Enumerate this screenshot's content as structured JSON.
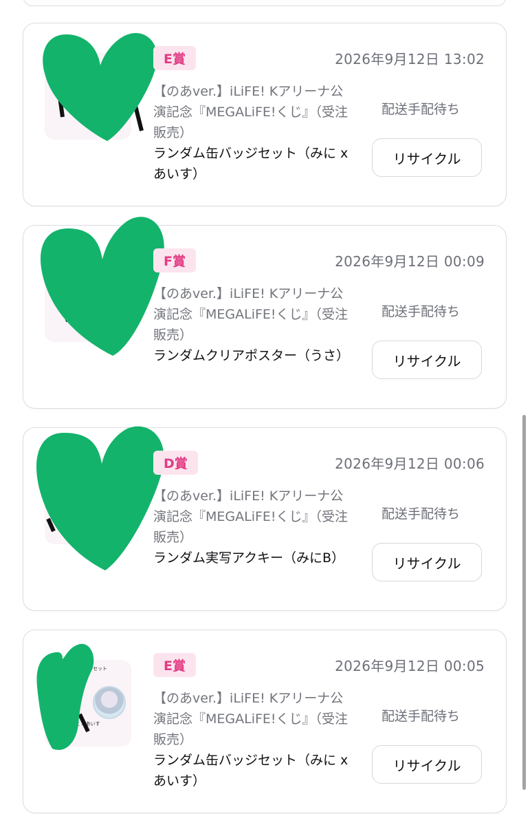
{
  "orders": [
    {
      "prize": "E賞",
      "datetime": "2026年9月12日 13:02",
      "title": "【のあver.】iLiFE! Kアリーナ公演記念『MEGALiFE!くじ』（受注販売）",
      "variant": "ランダム缶バッジセット（みに x あいす）",
      "status": "配送手配待ち",
      "action": "リサイクル"
    },
    {
      "prize": "F賞",
      "datetime": "2026年9月12日 00:09",
      "title": "【のあver.】iLiFE! Kアリーナ公演記念『MEGALiFE!くじ』（受注販売）",
      "variant": "ランダムクリアポスター（うさ）",
      "status": "配送手配待ち",
      "action": "リサイクル"
    },
    {
      "prize": "D賞",
      "datetime": "2026年9月12日 00:06",
      "title": "【のあver.】iLiFE! Kアリーナ公演記念『MEGALiFE!くじ』（受注販売）",
      "variant": "ランダム実写アクキー（みにB）",
      "status": "配送手配待ち",
      "action": "リサイクル"
    },
    {
      "prize": "E賞",
      "datetime": "2026年9月12日 00:05",
      "title": "【のあver.】iLiFE! Kアリーナ公演記念『MEGALiFE!くじ』（受注販売）",
      "variant": "ランダム缶バッジセット（みに x あいす）",
      "status": "配送手配待ち",
      "action": "リサイクル",
      "thumb_text": [
        "缶バッジセット",
        "に x あいす"
      ]
    }
  ],
  "colors": {
    "badge_bg": "#fce4ef",
    "badge_text": "#e23c84",
    "redaction": "#13b36b",
    "muted_text": "#6d6f78"
  }
}
